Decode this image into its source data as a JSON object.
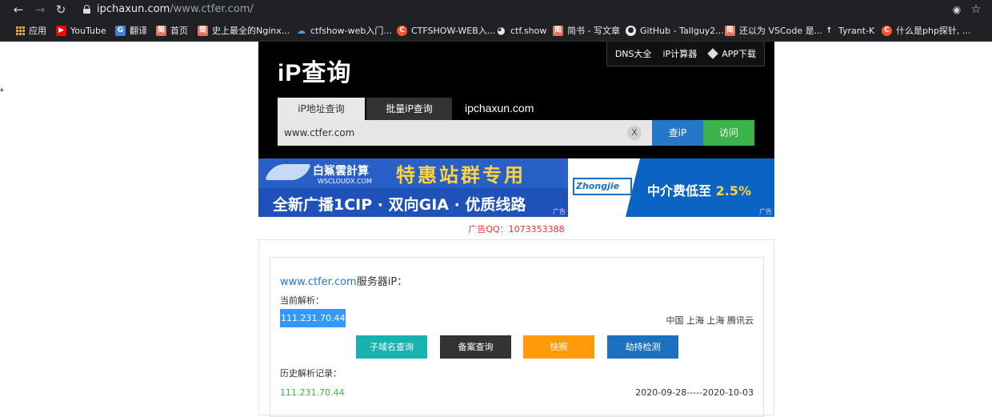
{
  "browser": {
    "url_host": "ipchaxun.com",
    "url_path": "/www.ctfer.com/",
    "bookmarks": [
      {
        "label": "应用",
        "icon": "apps-grid-icon"
      },
      {
        "label": "YouTube",
        "icon": "youtube-icon",
        "color": "#ff0000"
      },
      {
        "label": "翻译",
        "icon": "translate-icon",
        "color": "#4a7fd8"
      },
      {
        "label": "首页",
        "icon": "jianshu-icon",
        "color": "#ea6f5a"
      },
      {
        "label": "史上最全的Nginx...",
        "icon": "jianshu-icon",
        "color": "#ea6f5a"
      },
      {
        "label": "ctfshow-web入门...",
        "icon": "cloud-icon",
        "color": "#4aa3df"
      },
      {
        "label": "CTFSHOW-WEB入...",
        "icon": "csdn-icon",
        "color": "#fc5531"
      },
      {
        "label": "ctf.show",
        "icon": "globe-icon",
        "color": "#e8eaed"
      },
      {
        "label": "简书 - 写文章",
        "icon": "jianshu-icon",
        "color": "#ea6f5a"
      },
      {
        "label": "GitHub - Tallguy2...",
        "icon": "github-icon",
        "color": "#e8eaed"
      },
      {
        "label": "还以为 VSCode 是...",
        "icon": "jianshu-icon",
        "color": "#ea6f5a"
      },
      {
        "label": "Tyrant-K",
        "icon": "person-icon",
        "color": "#e8eaed"
      },
      {
        "label": "什么是php探针, ...",
        "icon": "csdn-icon",
        "color": "#fc5531"
      }
    ]
  },
  "header": {
    "links": [
      "DNS大全",
      "iP计算器",
      "APP下载"
    ],
    "logo": "iP查询",
    "tabs": [
      "iP地址查询",
      "批量iP查询"
    ],
    "site_domain": "ipchaxun.com",
    "search_value": "www.ctfer.com",
    "clear_label": "X",
    "query_label": "查iP",
    "visit_label": "访问"
  },
  "ads": {
    "left_brand": "白鯊雲計算",
    "left_url": "WSCLOUDX.COM",
    "left_headline": "特惠站群专用",
    "left_sub": "全新广播1CIP · 双向GIA · 优质线路",
    "right_logo": "Zhongjie",
    "right_text": "中介费低至",
    "right_pct": "2.5%",
    "ad_tag": "广告",
    "qq": "广告QQ：1073353388"
  },
  "result": {
    "domain": "www.ctfer.com",
    "title_suffix": "服务器iP：",
    "current_label": "当前解析：",
    "current_ip": "111.231.70.44",
    "location": "中国 上海 上海 腾讯云",
    "buttons": [
      "子域名查询",
      "备案查询",
      "快照",
      "劫持检测"
    ],
    "history_label": "历史解析记录：",
    "history_ip": "111.231.70.44",
    "history_range": "2020-09-28-----2020-10-03"
  }
}
